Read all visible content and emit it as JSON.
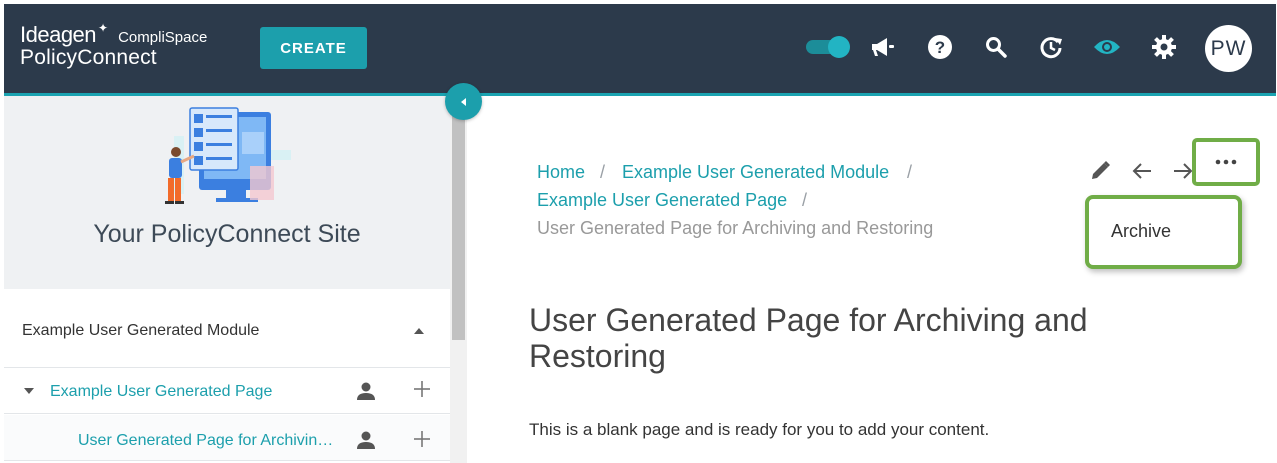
{
  "brand": {
    "name": "Ideagen",
    "product_line": "CompliSpace",
    "product": "PolicyConnect"
  },
  "toolbar": {
    "create_label": "CREATE",
    "toggle_on": true,
    "icons": [
      "megaphone-icon",
      "help-icon",
      "search-icon",
      "history-icon",
      "eye-icon",
      "gear-icon"
    ],
    "avatar_initials": "PW"
  },
  "sidebar": {
    "site_title": "Your PolicyConnect Site",
    "module": {
      "label": "Example User Generated Module",
      "expanded": true
    },
    "pages": [
      {
        "label": "Example User Generated Page",
        "expanded": true
      },
      {
        "label": "User Generated Page for Archivin…"
      }
    ]
  },
  "breadcrumb": {
    "home": "Home",
    "module": "Example User Generated Module",
    "page": "Example User Generated Page",
    "current": "User Generated Page for Archiving and Restoring",
    "separator": "/"
  },
  "main": {
    "title": "User Generated Page for Archiving and Restoring",
    "body": "This is a blank page and is ready for you to add your content."
  },
  "actions": {
    "menu_items": [
      "Archive"
    ]
  },
  "colors": {
    "topbar": "#2c3a4b",
    "accent": "#1c9fac",
    "highlight": "#70ad47"
  }
}
